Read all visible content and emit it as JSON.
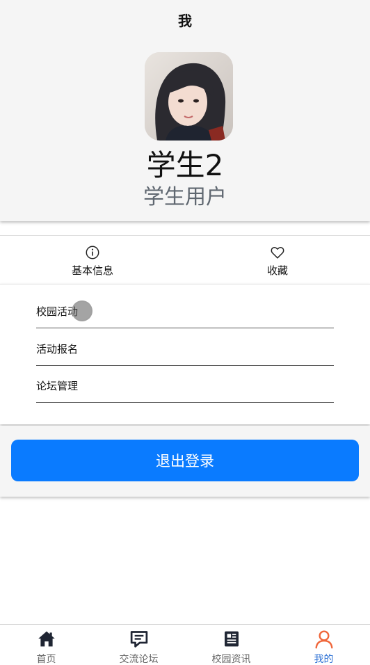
{
  "header": {
    "title": "我"
  },
  "profile": {
    "name": "学生2",
    "role": "学生用户"
  },
  "tabs": [
    {
      "label": "基本信息",
      "icon": "info-icon"
    },
    {
      "label": "收藏",
      "icon": "heart-icon"
    }
  ],
  "menu": {
    "items": [
      {
        "label": "校园活动"
      },
      {
        "label": "活动报名"
      },
      {
        "label": "论坛管理"
      }
    ]
  },
  "logout": {
    "label": "退出登录",
    "color": "#0a7bff"
  },
  "bottom_nav": {
    "items": [
      {
        "label": "首页",
        "icon": "home-icon"
      },
      {
        "label": "交流论坛",
        "icon": "chat-icon"
      },
      {
        "label": "校园资讯",
        "icon": "newspaper-icon"
      },
      {
        "label": "我的",
        "icon": "user-icon",
        "active": true
      }
    ],
    "active_color": "#2a6fd4",
    "active_icon_color": "#f0663a"
  }
}
